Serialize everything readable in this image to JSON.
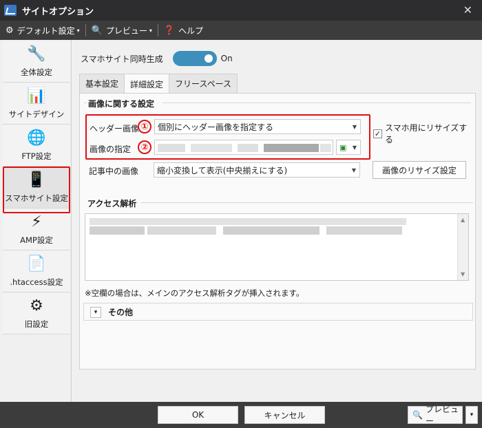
{
  "window": {
    "title": "サイトオプション",
    "close": "✕"
  },
  "menubar": {
    "items": [
      {
        "label": "デフォルト設定",
        "icon": "gear-icon",
        "glyph": "⚙"
      },
      {
        "label": "プレビュー",
        "icon": "preview-icon",
        "glyph": "🔍"
      },
      {
        "label": "ヘルプ",
        "icon": "help-icon",
        "glyph": "❓"
      }
    ],
    "caret": "▾"
  },
  "sidebar": {
    "items": [
      {
        "label": "全体設定",
        "icon": "tools-icon",
        "glyph": "🔧"
      },
      {
        "label": "サイトデザイン",
        "icon": "design-icon",
        "glyph": "📊"
      },
      {
        "label": "FTP設定",
        "icon": "ftp-network-icon",
        "glyph": "🌐"
      },
      {
        "label": "スマホサイト設定",
        "icon": "smartphone-icon",
        "glyph": "📱",
        "active": true
      },
      {
        "label": "AMP設定",
        "icon": "amp-lightning-icon",
        "glyph": "⚡"
      },
      {
        "label": ".htaccess設定",
        "icon": "htaccess-file-icon",
        "glyph": "📄"
      },
      {
        "label": "旧設定",
        "icon": "old-settings-gear-icon",
        "glyph": "⚙"
      }
    ]
  },
  "main": {
    "sync_label": "スマホサイト同時生成",
    "toggle_state": "On",
    "tabs": [
      "基本設定",
      "詳細設定",
      "フリースペース"
    ],
    "active_tab": "詳細設定",
    "image_group": {
      "title": "画像に関する設定",
      "header_image_label": "ヘッダー画像",
      "header_image_value": "個別にヘッダー画像を指定する",
      "annotation_1": "①",
      "annotation_2": "②",
      "resize_checkbox_label": "スマホ用にリサイズする",
      "resize_checked": true,
      "image_spec_label": "画像の指定",
      "article_image_label": "記事中の画像",
      "article_image_value": "縮小変換して表示(中央揃えにする)",
      "resize_button": "画像のリサイズ設定"
    },
    "access_group": {
      "title": "アクセス解析",
      "note": "※空欄の場合は、メインのアクセス解析タグが挿入されます。"
    },
    "other_group": {
      "title": "その他",
      "collapse_glyph": "▾"
    }
  },
  "footer": {
    "ok": "OK",
    "cancel": "キャンセル",
    "preview": "プレビュー",
    "preview_caret": "▾"
  },
  "colors": {
    "accent": "#3e8fbb",
    "highlight": "#e01010",
    "titlebar": "#2d2d30",
    "toolbar": "#3c3c3c"
  }
}
